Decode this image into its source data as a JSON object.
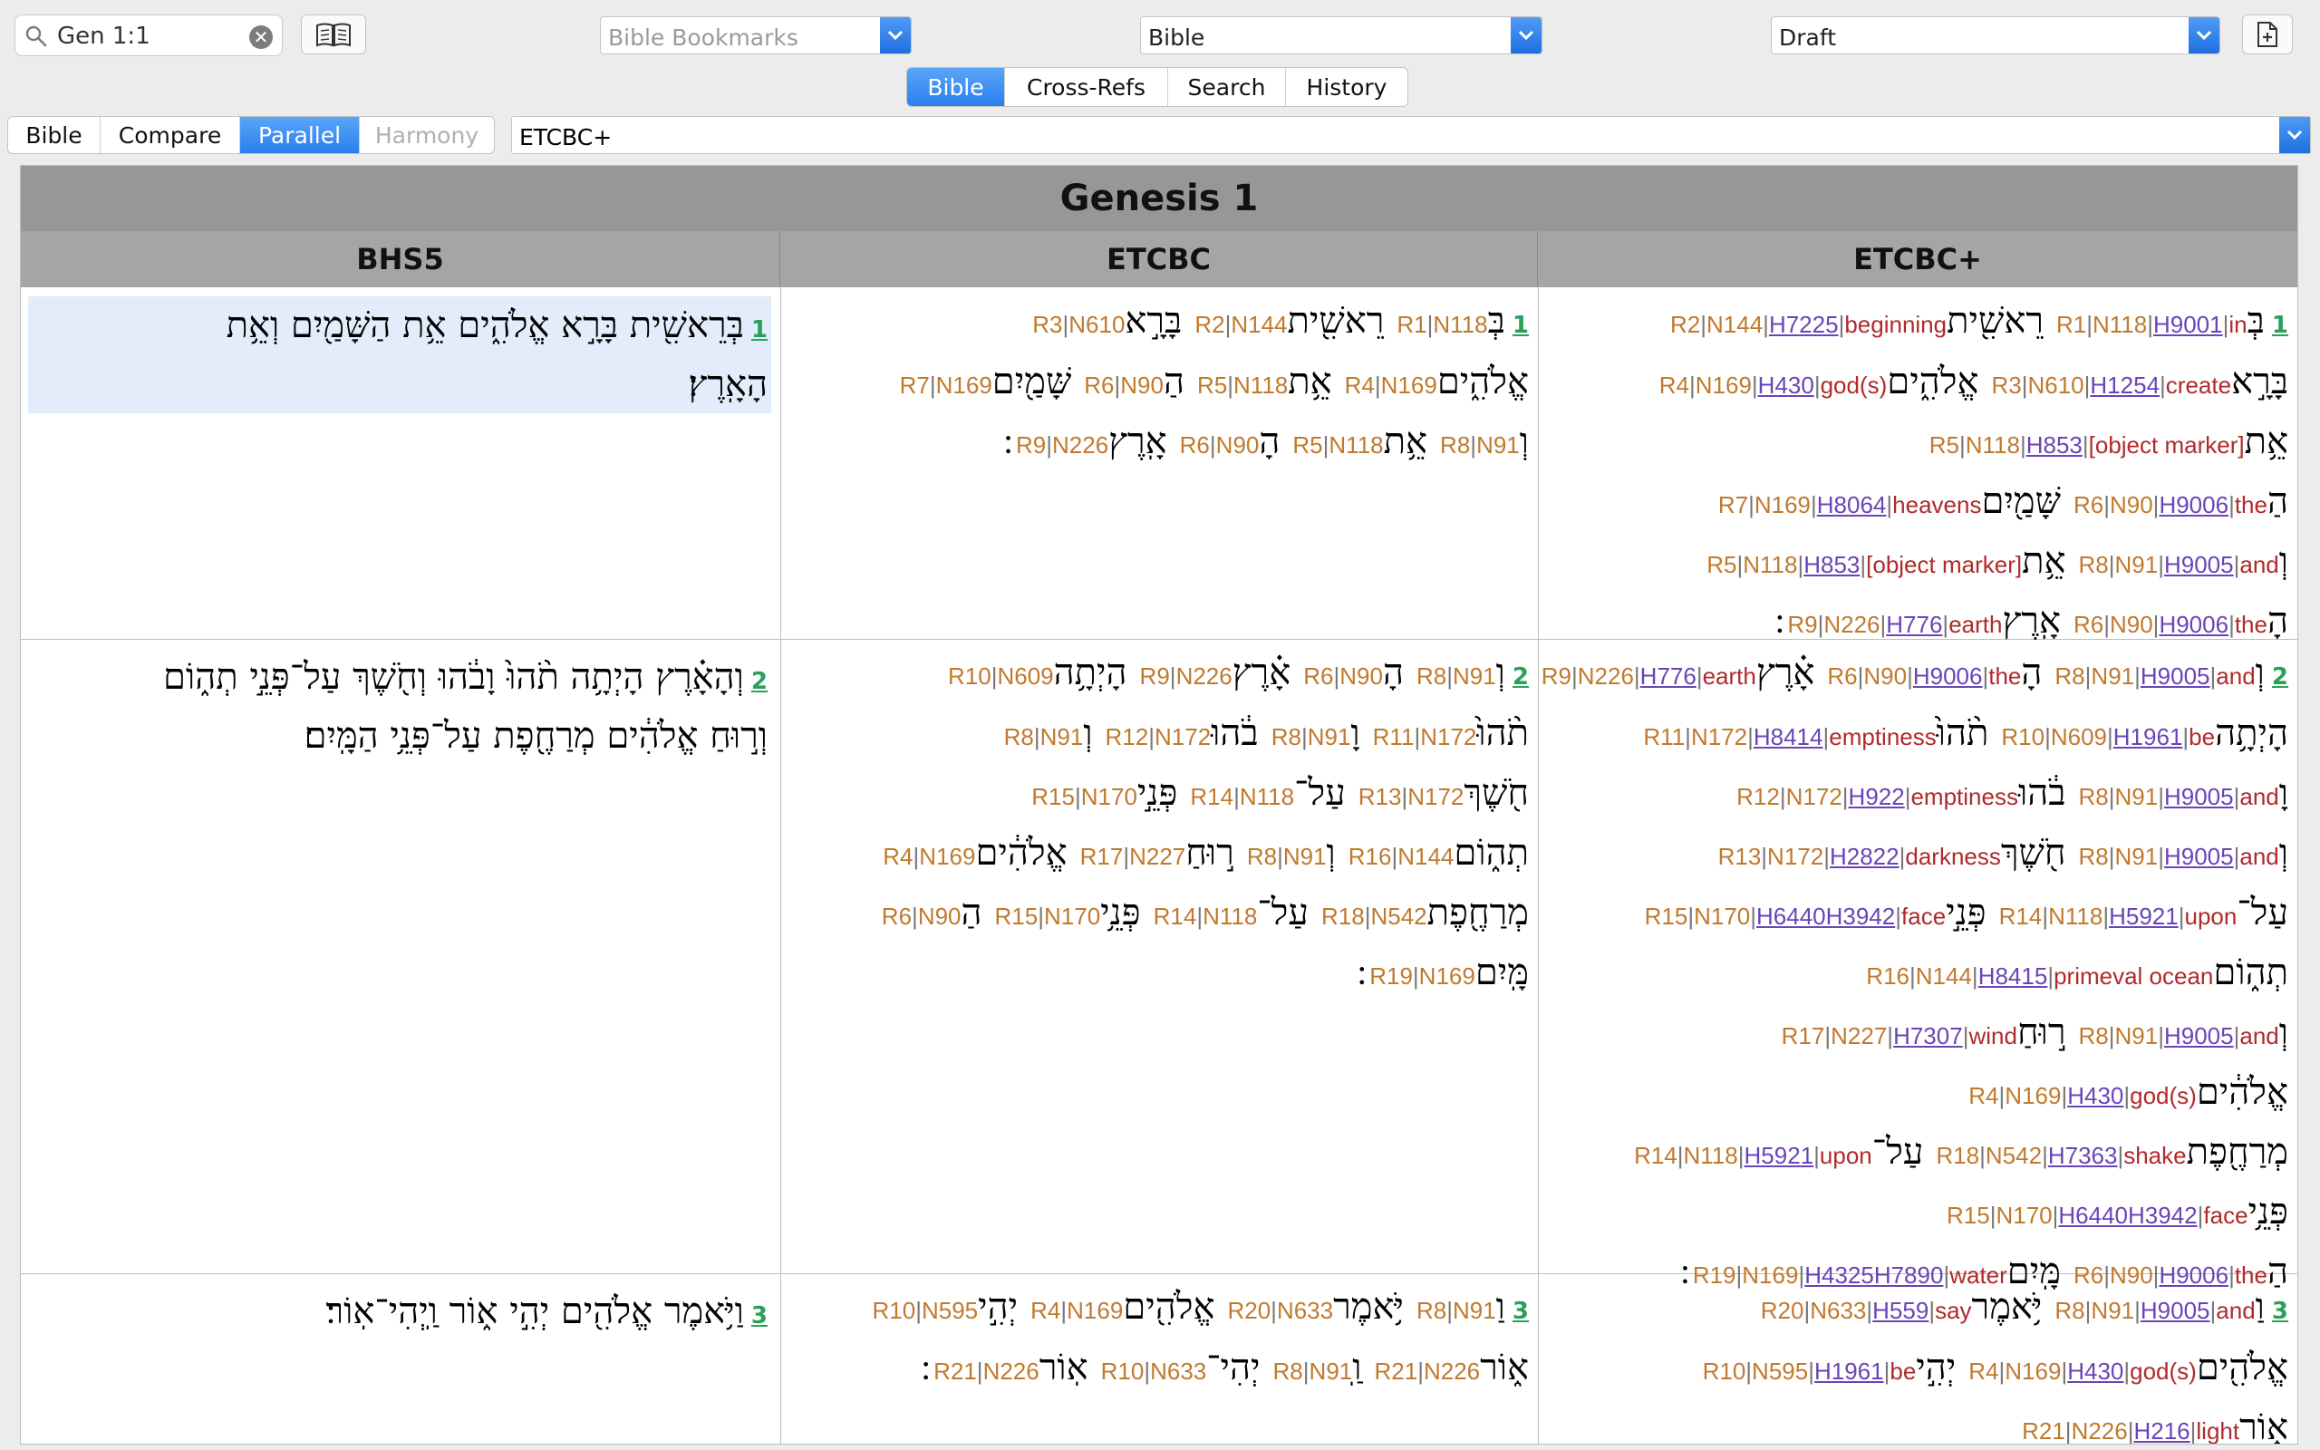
{
  "toolbar": {
    "search_value": "Gen 1:1",
    "bookmarks_placeholder": "Bible Bookmarks",
    "bible_select": "Bible",
    "draft_select": "Draft"
  },
  "top_tabs": [
    {
      "label": "Bible",
      "active": true
    },
    {
      "label": "Cross-Refs",
      "active": false
    },
    {
      "label": "Search",
      "active": false
    },
    {
      "label": "History",
      "active": false
    }
  ],
  "view_tabs": [
    {
      "label": "Bible",
      "state": "normal"
    },
    {
      "label": "Compare",
      "state": "normal"
    },
    {
      "label": "Parallel",
      "state": "active"
    },
    {
      "label": "Harmony",
      "state": "disabled"
    }
  ],
  "version_selector": "ETCBC+",
  "chapter_title": "Genesis 1",
  "columns": [
    "BHS5",
    "ETCBC",
    "ETCBC+"
  ],
  "colors": {
    "verse_number": "#2aa05a",
    "tag": "#c07a2e",
    "gloss": "#b02a2a",
    "strongs": "#6a44b8",
    "highlight": "#e3ecfb"
  },
  "rows": [
    {
      "verse": "1",
      "bhs5": [
        "בְּרֵאשִׁ֖ית בָּרָ֣א אֱלֹהִ֑ים אֵ֥ת הַשָּׁמַ֖יִם וְאֵ֥ת",
        "הָאָֽרֶץ׃"
      ],
      "etcbc": [
        [
          [
            "בְּ",
            "R1",
            "N118"
          ],
          [
            "רֵאשִׁ֖ית",
            "R2",
            "N144"
          ],
          [
            "בָּרָ֣א",
            "R3",
            "N610"
          ]
        ],
        [
          [
            "אֱלֹהִ֑ים",
            "R4",
            "N169"
          ],
          [
            "אֵ֥ת",
            "R5",
            "N118"
          ],
          [
            "הַ",
            "R6",
            "N90"
          ],
          [
            "שָּׁמַ֖יִם",
            "R7",
            "N169"
          ]
        ],
        [
          [
            "וְ",
            "R8",
            "N91"
          ],
          [
            "אֵ֥ת",
            "R5",
            "N118"
          ],
          [
            "הָ",
            "R6",
            "N90"
          ],
          [
            "אָֽרֶץ",
            "R9",
            "N226"
          ],
          [
            "׃"
          ]
        ]
      ],
      "etcbcplus": [
        [
          [
            "בְּ",
            "R1",
            "N118",
            "H9001",
            "in"
          ],
          [
            "רֵאשִׁ֖ית",
            "R2",
            "N144",
            "H7225",
            "beginning"
          ]
        ],
        [
          [
            "בָּרָ֣א",
            "R3",
            "N610",
            "H1254",
            "create"
          ],
          [
            "אֱלֹהִ֑ים",
            "R4",
            "N169",
            "H430",
            "god(s)"
          ]
        ],
        [
          [
            "אֵ֥ת",
            "R5",
            "N118",
            "H853",
            "[object marker]"
          ]
        ],
        [
          [
            "הַ",
            "R6",
            "N90",
            "H9006",
            "the"
          ],
          [
            "שָּׁמַ֖יִם",
            "R7",
            "N169",
            "H8064",
            "heavens"
          ]
        ],
        [
          [
            "וְ",
            "R8",
            "N91",
            "H9005",
            "and"
          ],
          [
            "אֵ֥ת",
            "R5",
            "N118",
            "H853",
            "[object marker]"
          ]
        ],
        [
          [
            "הָ",
            "R6",
            "N90",
            "H9006",
            "the"
          ],
          [
            "אָֽרֶץ",
            "R9",
            "N226",
            "H776",
            "earth"
          ],
          [
            "׃"
          ]
        ]
      ]
    },
    {
      "verse": "2",
      "bhs5": [
        "וְהָאָ֗רֶץ הָיְתָ֥ה תֹ֨הוּ֙ וָבֹ֔הוּ וְחֹ֖שֶׁךְ עַל־פְּנֵ֣י תְה֑וֹם",
        "וְר֣וּחַ אֱלֹהִ֔ים מְרַחֶ֖פֶת עַל־פְּנֵ֥י הַמָּֽיִם׃"
      ],
      "etcbc": [
        [
          [
            "וְ",
            "R8",
            "N91"
          ],
          [
            "הָ",
            "R6",
            "N90"
          ],
          [
            "אָ֗רֶץ",
            "R9",
            "N226"
          ],
          [
            "הָיְתָ֥ה",
            "R10",
            "N609"
          ]
        ],
        [
          [
            "תֹ֨הוּ֙",
            "R11",
            "N172"
          ],
          [
            "וָ",
            "R8",
            "N91"
          ],
          [
            "בֹ֔הוּ",
            "R12",
            "N172"
          ],
          [
            "וְ",
            "R8",
            "N91"
          ]
        ],
        [
          [
            "חֹ֖שֶׁךְ",
            "R13",
            "N172"
          ],
          [
            "עַל־",
            "R14",
            "N118"
          ],
          [
            "פְּנֵ֣י",
            "R15",
            "N170"
          ]
        ],
        [
          [
            "תְה֑וֹם",
            "R16",
            "N144"
          ],
          [
            "וְ",
            "R8",
            "N91"
          ],
          [
            "ר֣וּחַ",
            "R17",
            "N227"
          ],
          [
            "אֱלֹהִ֔ים",
            "R4",
            "N169"
          ]
        ],
        [
          [
            "מְרַחֶ֖פֶת",
            "R18",
            "N542"
          ],
          [
            "עַל־",
            "R14",
            "N118"
          ],
          [
            "פְּנֵ֥י",
            "R15",
            "N170"
          ],
          [
            "הַ",
            "R6",
            "N90"
          ]
        ],
        [
          [
            "מָּֽיִם",
            "R19",
            "N169"
          ],
          [
            "׃"
          ]
        ]
      ],
      "etcbcplus": [
        [
          [
            "וְ",
            "R8",
            "N91",
            "H9005",
            "and"
          ],
          [
            "הָ",
            "R6",
            "N90",
            "H9006",
            "the"
          ],
          [
            "אָ֗רֶץ",
            "R9",
            "N226",
            "H776",
            "earth"
          ]
        ],
        [
          [
            "הָיְתָ֥ה",
            "R10",
            "N609",
            "H1961",
            "be"
          ],
          [
            "תֹ֨הוּ֙",
            "R11",
            "N172",
            "H8414",
            "emptiness"
          ]
        ],
        [
          [
            "וָ",
            "R8",
            "N91",
            "H9005",
            "and"
          ],
          [
            "בֹ֔הוּ",
            "R12",
            "N172",
            "H922",
            "emptiness"
          ]
        ],
        [
          [
            "וְ",
            "R8",
            "N91",
            "H9005",
            "and"
          ],
          [
            "חֹ֖שֶׁךְ",
            "R13",
            "N172",
            "H2822",
            "darkness"
          ]
        ],
        [
          [
            "עַל־",
            "R14",
            "N118",
            "H5921",
            "upon"
          ],
          [
            "פְּנֵ֣י",
            "R15",
            "N170",
            "H6440H3942",
            "face"
          ]
        ],
        [
          [
            "תְה֑וֹם",
            "R16",
            "N144",
            "H8415",
            "primeval ocean"
          ]
        ],
        [
          [
            "וְ",
            "R8",
            "N91",
            "H9005",
            "and"
          ],
          [
            "ר֣וּחַ",
            "R17",
            "N227",
            "H7307",
            "wind"
          ]
        ],
        [
          [
            "אֱלֹהִ֔ים",
            "R4",
            "N169",
            "H430",
            "god(s)"
          ]
        ],
        [
          [
            "מְרַחֶ֖פֶת",
            "R18",
            "N542",
            "H7363",
            "shake"
          ],
          [
            "עַל־",
            "R14",
            "N118",
            "H5921",
            "upon"
          ]
        ],
        [
          [
            "פְּנֵ֥י",
            "R15",
            "N170",
            "H6440H3942",
            "face"
          ]
        ],
        [
          [
            "הַ",
            "R6",
            "N90",
            "H9006",
            "the"
          ],
          [
            "מָּֽיִם",
            "R19",
            "N169",
            "H4325H7890",
            "water"
          ],
          [
            "׃"
          ]
        ]
      ]
    },
    {
      "verse": "3",
      "bhs5": [
        "וַיֹּ֥אמֶר אֱלֹהִ֖ים יְהִ֣י א֑וֹר וַֽיְהִי־אֽוֹר׃"
      ],
      "etcbc": [
        [
          [
            "וַ",
            "R8",
            "N91"
          ],
          [
            "יֹּ֥אמֶר",
            "R20",
            "N633"
          ],
          [
            "אֱלֹהִ֖ים",
            "R4",
            "N169"
          ],
          [
            "יְהִ֣י",
            "R10",
            "N595"
          ]
        ],
        [
          [
            "א֑וֹר",
            "R21",
            "N226"
          ],
          [
            "וַֽ",
            "R8",
            "N91"
          ],
          [
            "יְהִי־",
            "R10",
            "N633"
          ],
          [
            "אֽוֹר",
            "R21",
            "N226"
          ],
          [
            "׃"
          ]
        ]
      ],
      "etcbcplus": [
        [
          [
            "וַ",
            "R8",
            "N91",
            "H9005",
            "and"
          ],
          [
            "יֹּ֥אמֶר",
            "R20",
            "N633",
            "H559",
            "say"
          ]
        ],
        [
          [
            "אֱלֹהִ֖ים",
            "R4",
            "N169",
            "H430",
            "god(s)"
          ],
          [
            "יְהִ֣י",
            "R10",
            "N595",
            "H1961",
            "be"
          ]
        ],
        [
          [
            "א֑וֹר",
            "R21",
            "N226",
            "H216",
            "light"
          ]
        ]
      ]
    }
  ]
}
